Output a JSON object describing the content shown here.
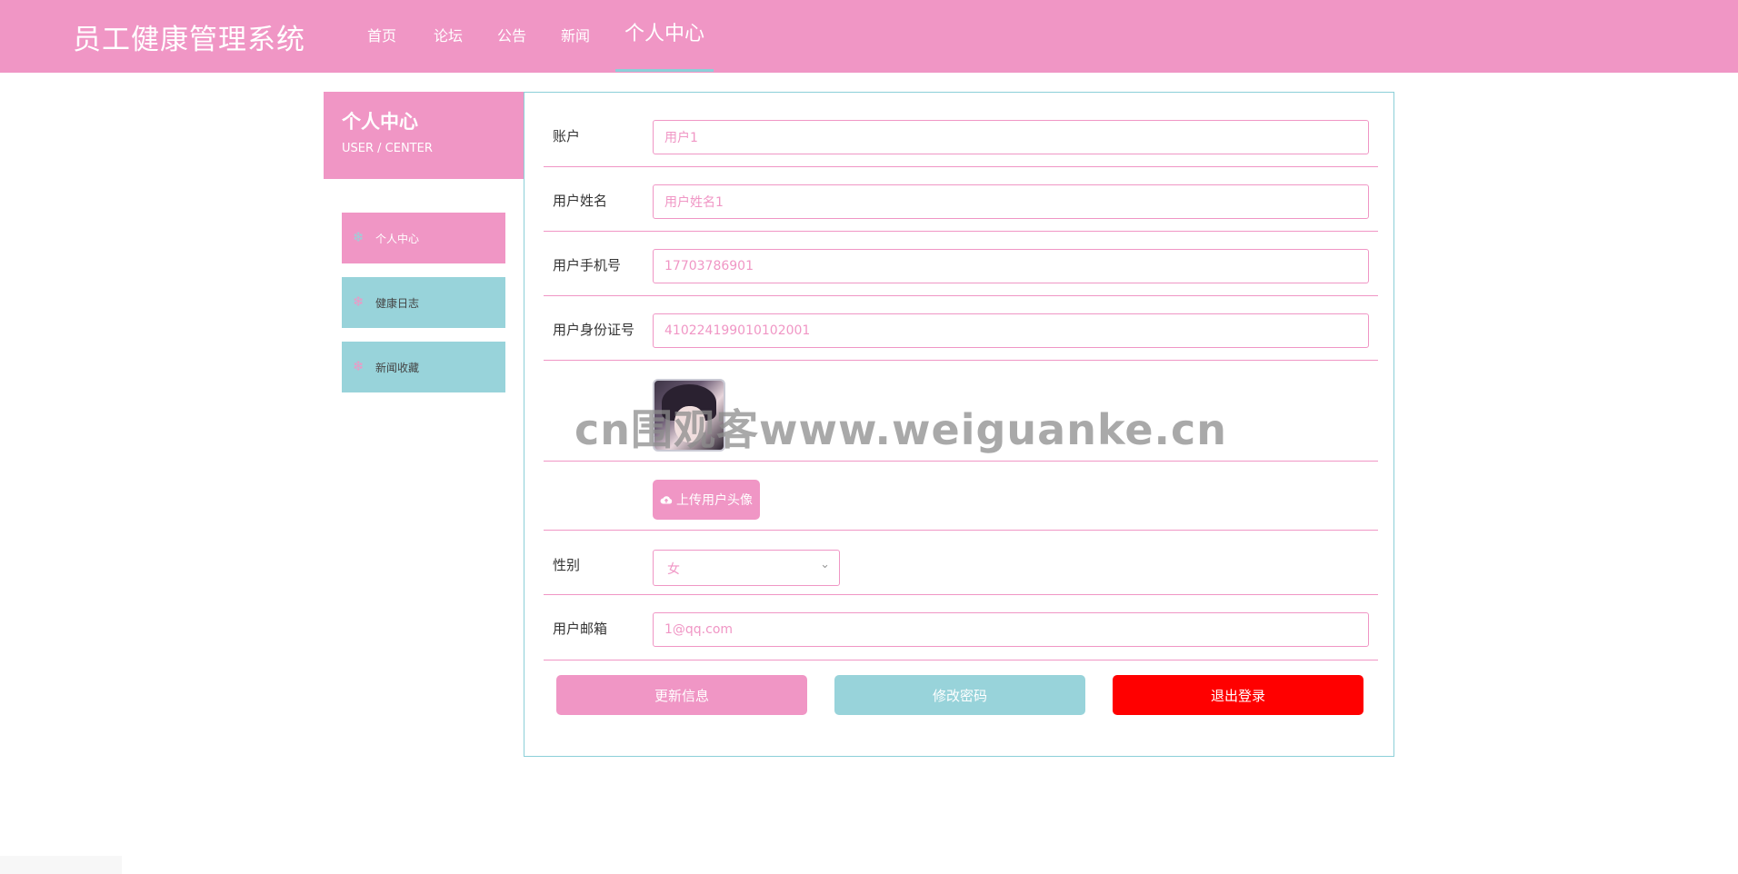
{
  "app": {
    "title": "员工健康管理系统"
  },
  "nav": {
    "items": [
      {
        "label": "首页"
      },
      {
        "label": "论坛"
      },
      {
        "label": "公告"
      },
      {
        "label": "新闻"
      },
      {
        "label": "个人中心"
      }
    ],
    "active_index": 4
  },
  "sidebar": {
    "title": "个人中心",
    "subtitle": "USER / CENTER",
    "items": [
      {
        "label": "个人中心",
        "icon": "snowflake-icon",
        "active": true
      },
      {
        "label": "健康日志",
        "icon": "snowflake-icon",
        "active": false
      },
      {
        "label": "新闻收藏",
        "icon": "snowflake-icon",
        "active": false
      }
    ]
  },
  "form": {
    "account": {
      "label": "账户",
      "value": "用户1"
    },
    "name": {
      "label": "用户姓名",
      "value": "用户姓名1"
    },
    "phone": {
      "label": "用户手机号",
      "value": "17703786901"
    },
    "id_card": {
      "label": "用户身份证号",
      "value": "410224199010102001"
    },
    "avatar": {
      "alt": "用户头像"
    },
    "upload": {
      "label": "上传用户头像",
      "icon": "cloud-upload-icon"
    },
    "gender": {
      "label": "性别",
      "value": "女"
    },
    "email": {
      "label": "用户邮箱",
      "value": "1@qq.com"
    }
  },
  "actions": {
    "update": "更新信息",
    "change_password": "修改密码",
    "logout": "退出登录"
  },
  "watermark": "cn围观客www.weiguanke.cn",
  "colors": {
    "primary": "#f096c5",
    "secondary": "#98d3da",
    "danger": "#ff0000",
    "panel_border": "#8ccfd8"
  }
}
